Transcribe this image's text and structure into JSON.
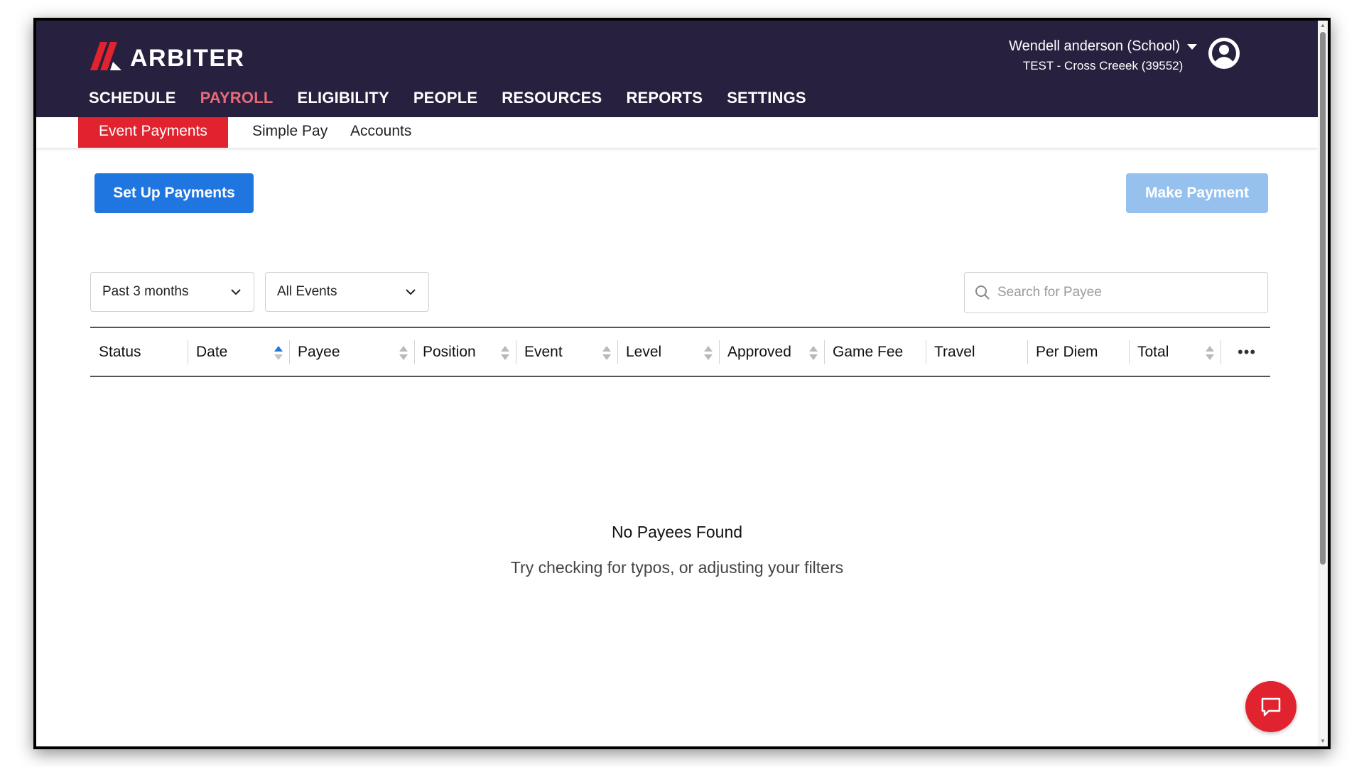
{
  "brand": {
    "name": "ARBITER",
    "logo_icon": "arbiter-logo-mark",
    "accent": "#e1222f",
    "header_bg": "#27213f"
  },
  "nav": {
    "items": [
      {
        "label": "SCHEDULE"
      },
      {
        "label": "PAYROLL"
      },
      {
        "label": "ELIGIBILITY"
      },
      {
        "label": "PEOPLE"
      },
      {
        "label": "RESOURCES"
      },
      {
        "label": "REPORTS"
      },
      {
        "label": "SETTINGS"
      }
    ],
    "active": "PAYROLL"
  },
  "user": {
    "name": "Wendell anderson (School)",
    "org": "TEST - Cross Creeek (39552)",
    "avatar_icon": "user-avatar-icon"
  },
  "subtabs": {
    "items": [
      {
        "label": "Event Payments"
      },
      {
        "label": "Simple Pay"
      },
      {
        "label": "Accounts"
      }
    ],
    "active": "Event Payments"
  },
  "actions": {
    "setup_label": "Set Up Payments",
    "make_label": "Make Payment",
    "setup_color": "#1f76e0",
    "make_color_disabled": "#96c1ee"
  },
  "filters": {
    "period": {
      "selected": "Past 3 months"
    },
    "events": {
      "selected": "All Events"
    },
    "search": {
      "placeholder": "Search for Payee",
      "value": ""
    }
  },
  "table": {
    "columns": [
      {
        "label": "Status"
      },
      {
        "label": "Date"
      },
      {
        "label": "Payee"
      },
      {
        "label": "Position"
      },
      {
        "label": "Event"
      },
      {
        "label": "Level"
      },
      {
        "label": "Approved"
      },
      {
        "label": "Game Fee"
      },
      {
        "label": "Travel"
      },
      {
        "label": "Per Diem"
      },
      {
        "label": "Total"
      }
    ],
    "sorted_by": "Date",
    "sort_direction": "ascending",
    "rows": []
  },
  "empty_state": {
    "title": "No Payees Found",
    "message": "Try checking for typos, or adjusting your filters"
  },
  "chat": {
    "icon": "chat-bubble-icon"
  }
}
